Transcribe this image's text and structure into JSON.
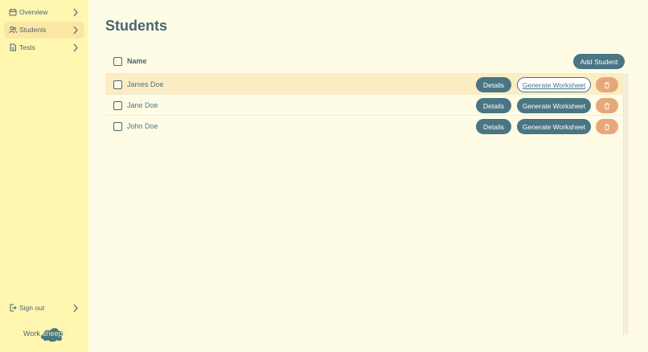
{
  "sidebar": {
    "items": [
      {
        "label": "Overview",
        "icon": "calendar-icon"
      },
      {
        "label": "Students",
        "icon": "users-icon"
      },
      {
        "label": "Tests",
        "icon": "document-icon"
      }
    ],
    "signout": {
      "label": "Sign out",
      "icon": "sign-out-icon"
    },
    "logo": {
      "part_a": "Work",
      "part_b": "sheeps"
    }
  },
  "main": {
    "title": "Students",
    "table": {
      "header": {
        "name": "Name",
        "add_label": "Add Student"
      },
      "rows": [
        {
          "name": "James Doe",
          "details": "Details",
          "generate": "Generate Worksheet"
        },
        {
          "name": "Jane Doe",
          "details": "Details",
          "generate": "Generate Worksheet"
        },
        {
          "name": "John Doe",
          "details": "Details",
          "generate": "Generate Worksheet"
        }
      ]
    }
  },
  "colors": {
    "sidebar_bg": "#fff6b0",
    "page_bg": "#fffce6",
    "primary": "#4a7584",
    "danger": "#e8a779",
    "active": "#fbe7a3"
  }
}
